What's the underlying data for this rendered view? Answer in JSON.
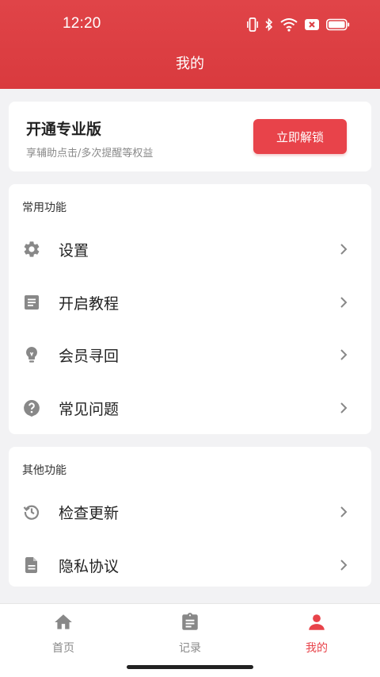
{
  "status_bar": {
    "time": "12:20",
    "icons": [
      "vibrate-icon",
      "bluetooth-icon",
      "wifi-icon",
      "sim-off-icon",
      "battery-icon"
    ]
  },
  "nav": {
    "title": "我的"
  },
  "pro_card": {
    "title": "开通专业版",
    "subtitle": "享辅助点击/多次提醒等权益",
    "button_label": "立即解锁"
  },
  "common_section": {
    "title": "常用功能",
    "items": [
      {
        "label": "设置",
        "icon": "gear-icon"
      },
      {
        "label": "开启教程",
        "icon": "document-icon"
      },
      {
        "label": "会员寻回",
        "icon": "lightbulb-icon"
      },
      {
        "label": "常见问题",
        "icon": "help-circle-icon"
      }
    ]
  },
  "other_section": {
    "title": "其他功能",
    "items": [
      {
        "label": "检查更新",
        "icon": "update-icon"
      },
      {
        "label": "隐私协议",
        "icon": "file-icon"
      }
    ]
  },
  "tabbar": {
    "items": [
      {
        "label": "首页",
        "icon": "home-icon",
        "active": false
      },
      {
        "label": "记录",
        "icon": "clipboard-icon",
        "active": false
      },
      {
        "label": "我的",
        "icon": "person-icon",
        "active": true
      }
    ]
  },
  "colors": {
    "brand_red": "#e8434a",
    "header_red": "#dc3d42",
    "icon_gray": "#888888",
    "text_gray": "#8a8a8a",
    "background": "#f2f2f4"
  }
}
